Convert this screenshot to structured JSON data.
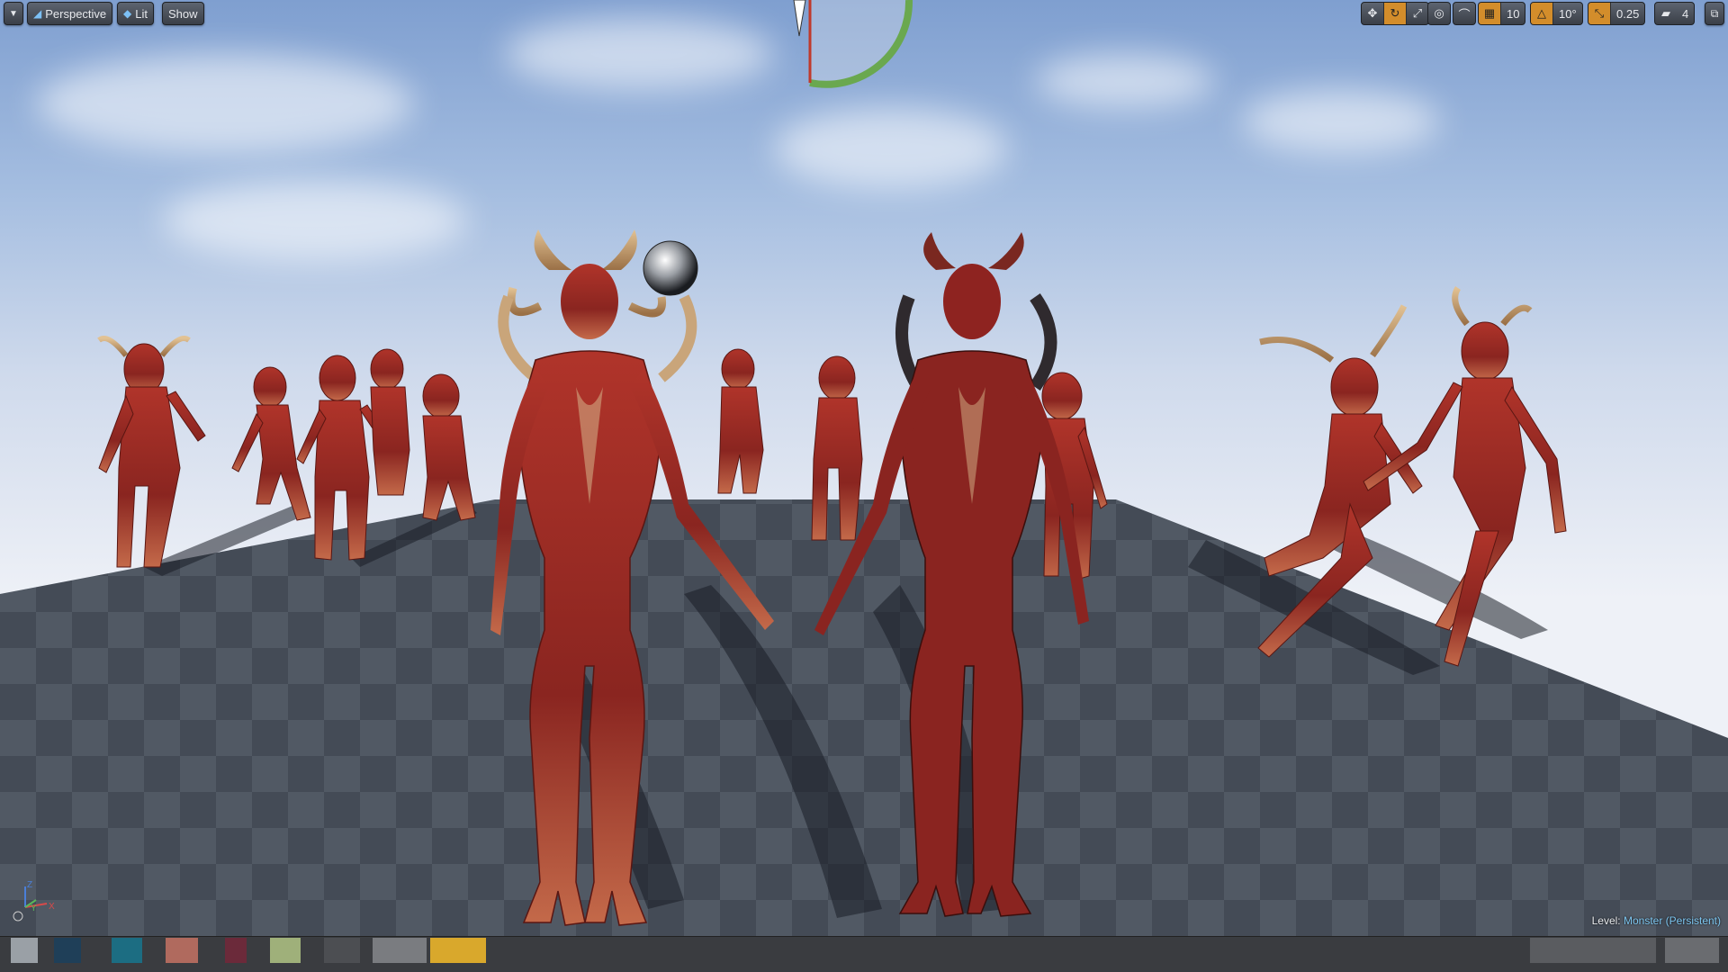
{
  "toolbar_left": {
    "dropdown_icon": "chevron-down-icon",
    "perspective_label": "Perspective",
    "lit_label": "Lit",
    "show_label": "Show"
  },
  "toolbar_right": {
    "grid_snap_value": "10",
    "rotation_snap_value": "10°",
    "scale_snap_value": "0.25",
    "camera_speed_value": "4"
  },
  "level": {
    "label": "Level:",
    "value": "Monster (Persistent)"
  },
  "axis_indicator": {
    "z": "Z",
    "y": "Y",
    "x": "X"
  },
  "colors": {
    "accent_orange": "#d38d2b",
    "level_value": "#7dc6f0",
    "creature_red": "#a82a22"
  }
}
